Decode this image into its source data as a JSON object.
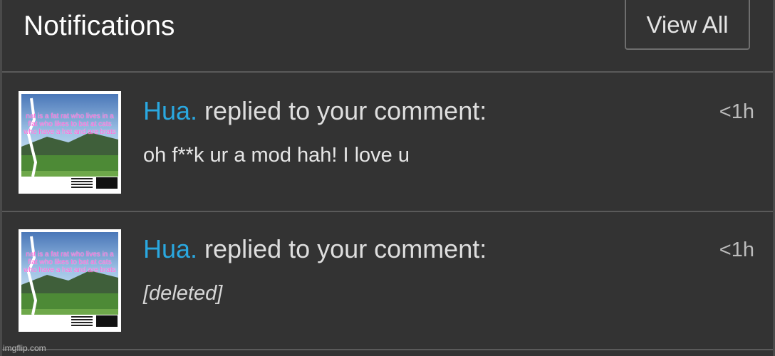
{
  "header": {
    "title": "Notifications",
    "view_all_label": "View All"
  },
  "notifications": [
    {
      "username": "Hua.",
      "action": " replied to your comment:",
      "time": "<1h",
      "message": "oh f**k ur a mod hah! I love u",
      "avatar_text": "nat is a fat rat who lives in a flat who likes to bat at cats who have a hat and are brats"
    },
    {
      "username": "Hua.",
      "action": " replied to your comment:",
      "time": "<1h",
      "message": "[deleted]",
      "avatar_text": "nat is a fat rat who lives in a flat who likes to bat at cats who have a hat and are brats"
    }
  ],
  "watermark": "imgflip.com",
  "colors": {
    "background": "#333333",
    "username": "#2aa8e0",
    "avatar_text": "#ff5fd7"
  }
}
